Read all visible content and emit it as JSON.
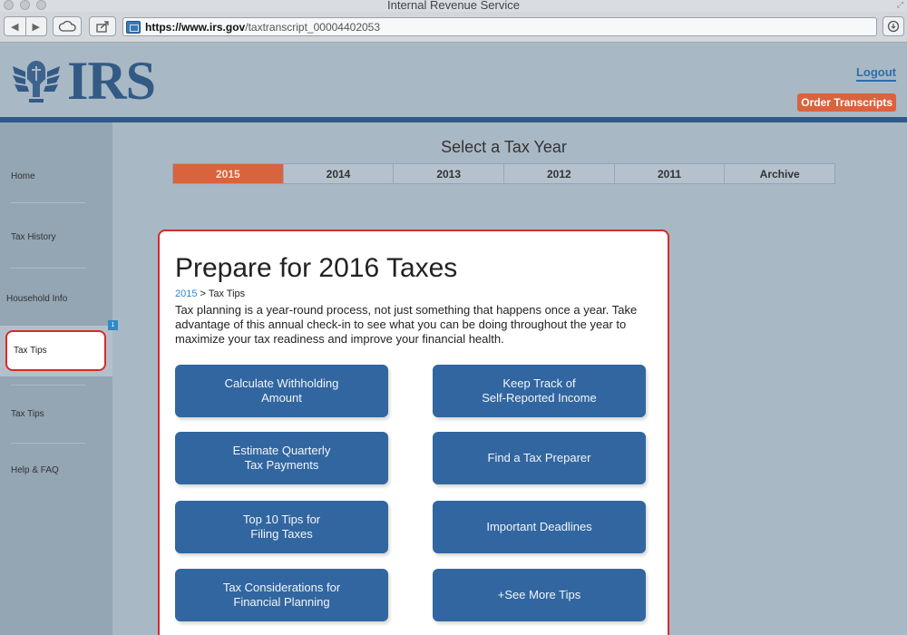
{
  "window": {
    "title": "Internal Revenue Service"
  },
  "browser": {
    "url_host": "https://www.irs.gov",
    "url_path": "/taxtranscript_00004402053"
  },
  "header": {
    "logo_text": "IRS",
    "logout_label": "Logout",
    "order_label": "Order Transcripts"
  },
  "sidebar": {
    "items": [
      {
        "label": "Home"
      },
      {
        "label": "Tax History"
      },
      {
        "label": "Household Info"
      },
      {
        "label": "Tax Tips"
      },
      {
        "label": "Tax Tips"
      },
      {
        "label": "Help & FAQ"
      }
    ],
    "badge": "1"
  },
  "years": {
    "title": "Select a Tax Year",
    "tabs": [
      "2015",
      "2014",
      "2013",
      "2012",
      "2011",
      "Archive"
    ],
    "selected": "2015"
  },
  "main": {
    "title": "Prepare for 2016 Taxes",
    "crumb_link": "2015",
    "crumb_sep": " > ",
    "crumb_current": "Tax Tips",
    "body": "Tax planning is a year-round process, not just something that happens once a year. Take advantage of this annual check-in to see what you can be doing throughout the year to maximize your tax readiness and improve your financial health.",
    "buttons": [
      "Calculate Withholding\nAmount",
      "Keep Track of\nSelf-Reported Income",
      "Estimate Quarterly\nTax Payments",
      "Find a Tax Preparer",
      "Top 10 Tips for\nFiling Taxes",
      "Important Deadlines",
      "Tax Considerations for\nFinancial Planning",
      "+See More Tips"
    ]
  },
  "colors": {
    "accent": "#d9633d",
    "brand": "#2d5a86",
    "button": "#3266a0",
    "highlight": "#d92a2a"
  }
}
